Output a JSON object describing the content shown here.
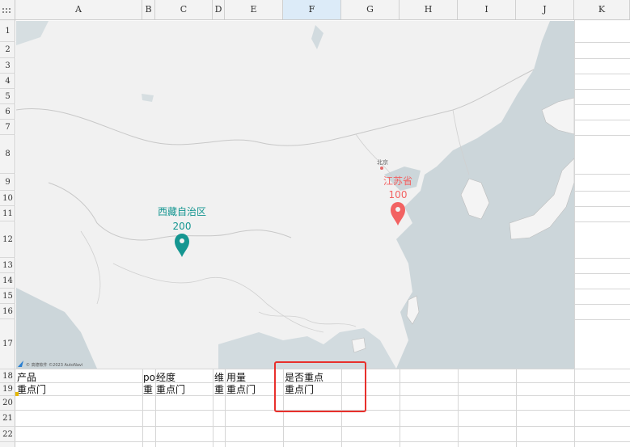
{
  "columns": [
    "A",
    "B",
    "C",
    "D",
    "E",
    "F",
    "G",
    "H",
    "I",
    "J",
    "K"
  ],
  "selected_column": "F",
  "rows": [
    "1",
    "2",
    "3",
    "4",
    "5",
    "6",
    "7",
    "8",
    "9",
    "10",
    "11",
    "12",
    "13",
    "14",
    "15",
    "16",
    "17",
    "18",
    "19",
    "20",
    "21",
    "22"
  ],
  "map": {
    "markers": [
      {
        "name": "西藏自治区",
        "value": "200",
        "color": "#159691"
      },
      {
        "name": "江苏省",
        "value": "100",
        "color": "#f26262"
      }
    ],
    "city_label": "北京",
    "attribution": "© 高德软件 ©2023 AutoNavi"
  },
  "cells": {
    "r18": {
      "A": "产品",
      "B": "po",
      "C": "经度",
      "D": "维",
      "E": "用量",
      "F": "是否重点"
    },
    "r19": {
      "A": "重点门",
      "B": "重",
      "C": "重点门",
      "D": "重",
      "E": "重点门",
      "F": "重点门"
    }
  },
  "colors": {
    "highlight_box": "#e8302c",
    "selected_header": "#dcebf8"
  }
}
